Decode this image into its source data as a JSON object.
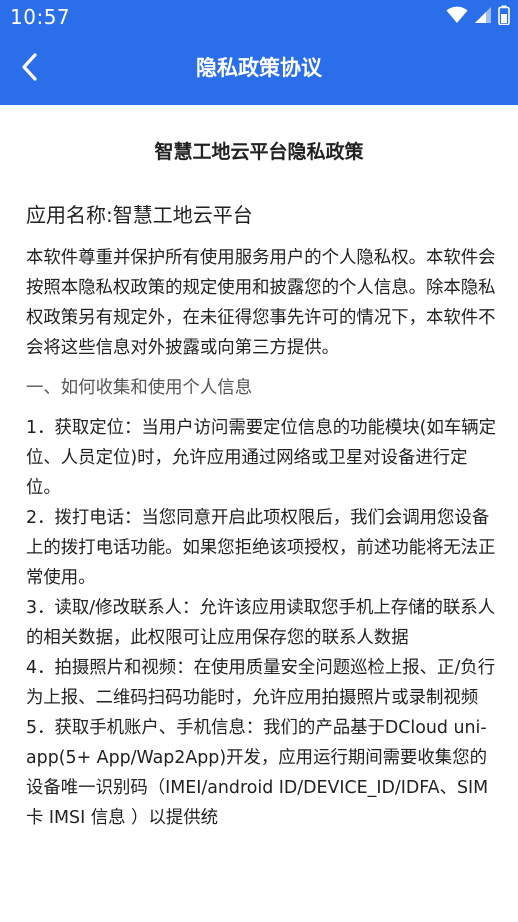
{
  "status_bar": {
    "time": "10:57",
    "icons": [
      "wifi-icon",
      "signal-icon",
      "battery-icon"
    ]
  },
  "nav": {
    "back_icon": "chevron-left-icon",
    "title": "隐私政策协议"
  },
  "document": {
    "title": "智慧工地云平台隐私政策",
    "app_name": "应用名称:智慧工地云平台",
    "intro": "本软件尊重并保护所有使用服务用户的个人隐私权。本软件会按照本隐私权政策的规定使用和披露您的个人信息。除本隐私权政策另有规定外，在未征得您事先许可的情况下，本软件不会将这些信息对外披露或向第三方提供。",
    "section_1_heading": "一、如何收集和使用个人信息",
    "items": [
      "1．获取定位：当用户访问需要定位信息的功能模块(如车辆定位、人员定位)时，允许应用通过网络或卫星对设备进行定位。",
      "2．拨打电话：当您同意开启此项权限后，我们会调用您设备上的拨打电话功能。如果您拒绝该项授权，前述功能将无法正常使用。",
      "3．读取/修改联系人：允许该应用读取您手机上存储的联系人的相关数据，此权限可让应用保存您的联系人数据",
      "4．拍摄照片和视频：在使用质量安全问题巡检上报、正/负行为上报、二维码扫码功能时，允许应用拍摄照片或录制视频",
      "5．获取手机账户、手机信息：我们的产品基于DCloud uni-app(5+ App/Wap2App)开发，应用运行期间需要收集您的设备唯一识别码（IMEI/android ID/DEVICE_ID/IDFA、SIM 卡 IMSI 信息 ）以提供统"
    ]
  },
  "colors": {
    "primary": "#2b6ee9",
    "text": "#222222",
    "muted": "#555555",
    "background": "#ffffff"
  }
}
